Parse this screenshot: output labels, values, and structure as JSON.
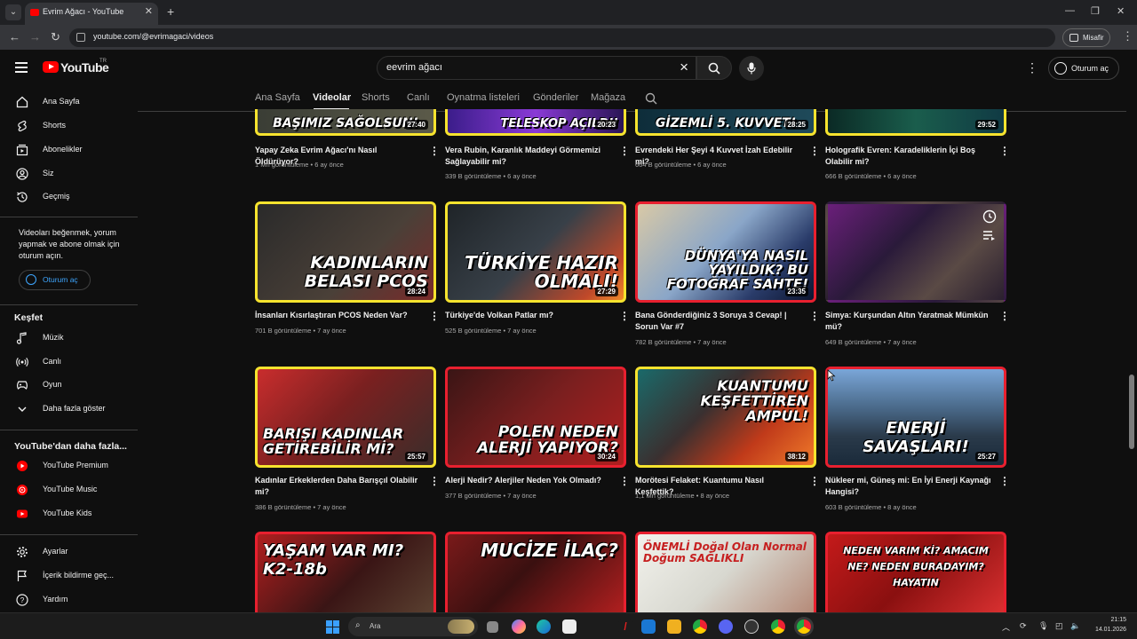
{
  "browser": {
    "tab_title": "Evrim Ağacı - YouTube",
    "url": "youtube.com/@evrimagaci/videos",
    "guest_label": "Misafir"
  },
  "header": {
    "logo_text": "YouTube",
    "country_code": "TR",
    "search_value": "eevrim ağacı",
    "signin_label": "Oturum aç"
  },
  "channel_tabs": [
    "Ana Sayfa",
    "Videolar",
    "Shorts",
    "Canlı",
    "Oynatma listeleri",
    "Gönderiler",
    "Mağaza"
  ],
  "active_tab": "Videolar",
  "sidebar": {
    "main": [
      {
        "label": "Ana Sayfa",
        "icon": "home-icon"
      },
      {
        "label": "Shorts",
        "icon": "shorts-icon"
      },
      {
        "label": "Abonelikler",
        "icon": "subscriptions-icon"
      },
      {
        "label": "Siz",
        "icon": "you-icon"
      },
      {
        "label": "Geçmiş",
        "icon": "history-icon"
      }
    ],
    "signin_note": "Videoları beğenmek, yorum yapmak ve abone olmak için oturum açın.",
    "signin_button": "Oturum aç",
    "explore_title": "Keşfet",
    "explore": [
      {
        "label": "Müzik",
        "icon": "music-icon"
      },
      {
        "label": "Canlı",
        "icon": "live-icon"
      },
      {
        "label": "Oyun",
        "icon": "gaming-icon"
      },
      {
        "label": "Daha fazla göster",
        "icon": "chevron-down-icon"
      }
    ],
    "more_title": "YouTube'dan daha fazla...",
    "more": [
      {
        "label": "YouTube Premium",
        "icon": "youtube-premium-icon"
      },
      {
        "label": "YouTube Music",
        "icon": "youtube-music-icon"
      },
      {
        "label": "YouTube Kids",
        "icon": "youtube-kids-icon"
      }
    ],
    "footer": [
      {
        "label": "Ayarlar",
        "icon": "settings-icon"
      },
      {
        "label": "İçerik bildirme geç...",
        "icon": "flag-icon"
      },
      {
        "label": "Yardım",
        "icon": "help-icon"
      }
    ]
  },
  "videos": [
    {
      "caption": "BAŞIMIZ SAĞOLSUN!",
      "duration": "27:40",
      "title": "Yapay Zeka Evrim Ağacı'nı Nasıl Öldürüyor?",
      "meta": "1 Mn görüntüleme • 6 ay önce"
    },
    {
      "caption": "TELESKOP AÇILDI!",
      "duration": "20:23",
      "title": "Vera Rubin, Karanlık Maddeyi Görmemizi Sağlayabilir mi?",
      "meta": "339 B görüntüleme • 6 ay önce"
    },
    {
      "caption": "GİZEMLİ 5. KUVVET!",
      "duration": "28:25",
      "title": "Evrendeki Her Şeyi 4 Kuvvet İzah Edebilir mi?",
      "meta": "664 B görüntüleme • 6 ay önce"
    },
    {
      "caption": "",
      "duration": "29:52",
      "title": "Holografik Evren: Karadeliklerin İçi Boş Olabilir mi?",
      "meta": "666 B görüntüleme • 6 ay önce"
    },
    {
      "caption": "KADINLARIN BELASI PCOS",
      "duration": "28:24",
      "title": "İnsanları Kısırlaştıran PCOS Neden Var?",
      "meta": "701 B görüntüleme • 7 ay önce"
    },
    {
      "caption": "TÜRKİYE HAZIR OLMALI!",
      "duration": "27:29",
      "title": "Türkiye'de Volkan Patlar mı?",
      "meta": "525 B görüntüleme • 7 ay önce"
    },
    {
      "caption": "DÜNYA'YA NASIL YAYILDIK? BU FOTOĞRAF SAHTE!",
      "duration": "23:35",
      "title": "Bana Gönderdiğiniz 3 Soruya 3 Cevap! | Sorun Var #7",
      "meta": "782 B görüntüleme • 7 ay önce"
    },
    {
      "caption": "",
      "duration": "",
      "title": "Simya: Kurşundan Altın Yaratmak Mümkün mü?",
      "meta": "649 B görüntüleme • 7 ay önce"
    },
    {
      "caption": "BARIŞI KADINLAR GETİREBİLİR Mİ?",
      "duration": "25:57",
      "title": "Kadınlar Erkeklerden Daha Barışçıl Olabilir mi?",
      "meta": "386 B görüntüleme • 7 ay önce"
    },
    {
      "caption": "POLEN NEDEN ALERJİ YAPIYOR?",
      "duration": "30:24",
      "title": "Alerji Nedir? Alerjiler Neden Yok Olmadı?",
      "meta": "377 B görüntüleme • 7 ay önce"
    },
    {
      "caption": "KUANTUMU KEŞFETTİREN AMPUL!",
      "duration": "38:12",
      "title": "Morötesi Felaket: Kuantumu Nasıl Keşfettik?",
      "meta": "1,1 Mn görüntüleme • 8 ay önce"
    },
    {
      "caption": "ENERJİ SAVAŞLARI!",
      "duration": "25:27",
      "title": "Nükleer mi, Güneş mi: En İyi Enerji Kaynağı Hangisi?",
      "meta": "603 B görüntüleme • 8 ay önce"
    },
    {
      "caption": "YAŞAM VAR MI? K2-18b",
      "duration": "",
      "title": "",
      "meta": ""
    },
    {
      "caption": "MUCİZE İLAÇ?",
      "duration": "",
      "title": "",
      "meta": ""
    },
    {
      "caption": "ÖNEMLİ Doğal Olan Normal Doğum SAĞLIKLI",
      "duration": "",
      "title": "",
      "meta": ""
    },
    {
      "caption": "NEDEN VARIM Kİ? AMACIM NE? NEDEN BURADAYIM? HAYATIN",
      "duration": "",
      "title": "",
      "meta": ""
    }
  ],
  "taskbar": {
    "search_label": "Ara",
    "time": "21:15",
    "date": "14.01.2026"
  }
}
